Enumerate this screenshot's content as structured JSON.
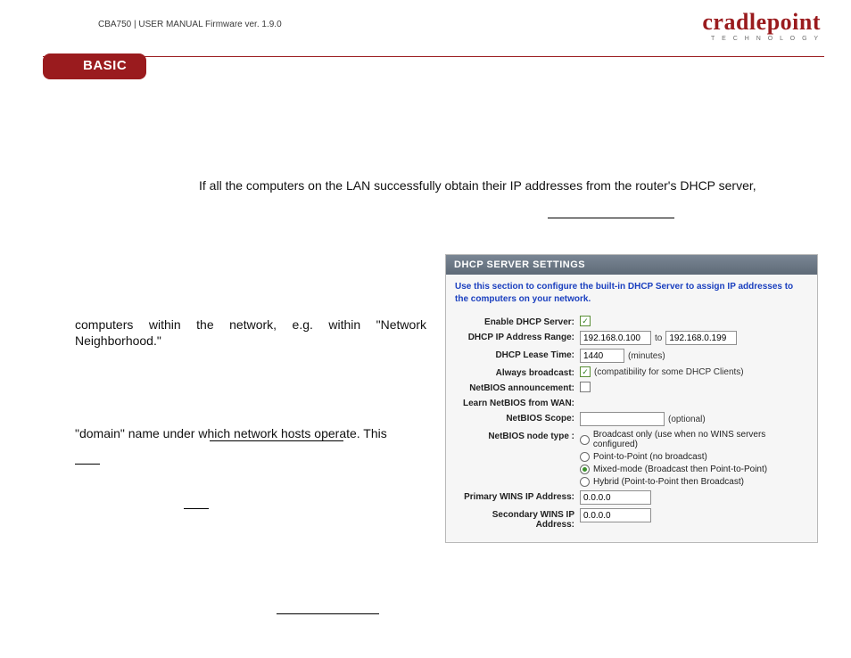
{
  "header": {
    "manual_line": "CBA750 | USER MANUAL Firmware ver. 1.9.0",
    "brand_main": "cradlepoint",
    "brand_sub": "T E C H N O L O G Y",
    "tab": "BASIC"
  },
  "body": {
    "line1": "If all the computers on the LAN successfully obtain their IP addresses from the router's DHCP server,",
    "para2": "computers within the network, e.g. within \"Network Neighborhood.\"",
    "para3": "\"domain\" name under which network hosts operate. This"
  },
  "panel": {
    "title": "DHCP SERVER SETTINGS",
    "note": "Use this section to configure the built-in DHCP Server to assign IP addresses to the computers on your network.",
    "labels": {
      "enable": "Enable DHCP Server:",
      "range": "DHCP IP Address Range:",
      "lease": "DHCP Lease Time:",
      "always": "Always broadcast:",
      "netbios_ann": "NetBIOS announcement:",
      "learn_netbios": "Learn NetBIOS from WAN:",
      "netbios_scope": "NetBIOS Scope:",
      "netbios_node": "NetBIOS node type :",
      "primary_wins": "Primary WINS IP Address:",
      "secondary_wins": "Secondary WINS IP Address:"
    },
    "values": {
      "range_from": "192.168.0.100",
      "range_to_word": "to",
      "range_to": "192.168.0.199",
      "lease": "1440",
      "lease_unit": "(minutes)",
      "always_hint": "(compatibility for some DHCP Clients)",
      "scope_hint": "(optional)",
      "primary_wins": "0.0.0.0",
      "secondary_wins": "0.0.0.0",
      "enable_checked": "✓",
      "always_checked": "✓"
    },
    "radios": {
      "r1": "Broadcast only (use when no WINS servers configured)",
      "r2": "Point-to-Point (no broadcast)",
      "r3": "Mixed-mode (Broadcast then Point-to-Point)",
      "r4": "Hybrid (Point-to-Point then Broadcast)"
    }
  }
}
